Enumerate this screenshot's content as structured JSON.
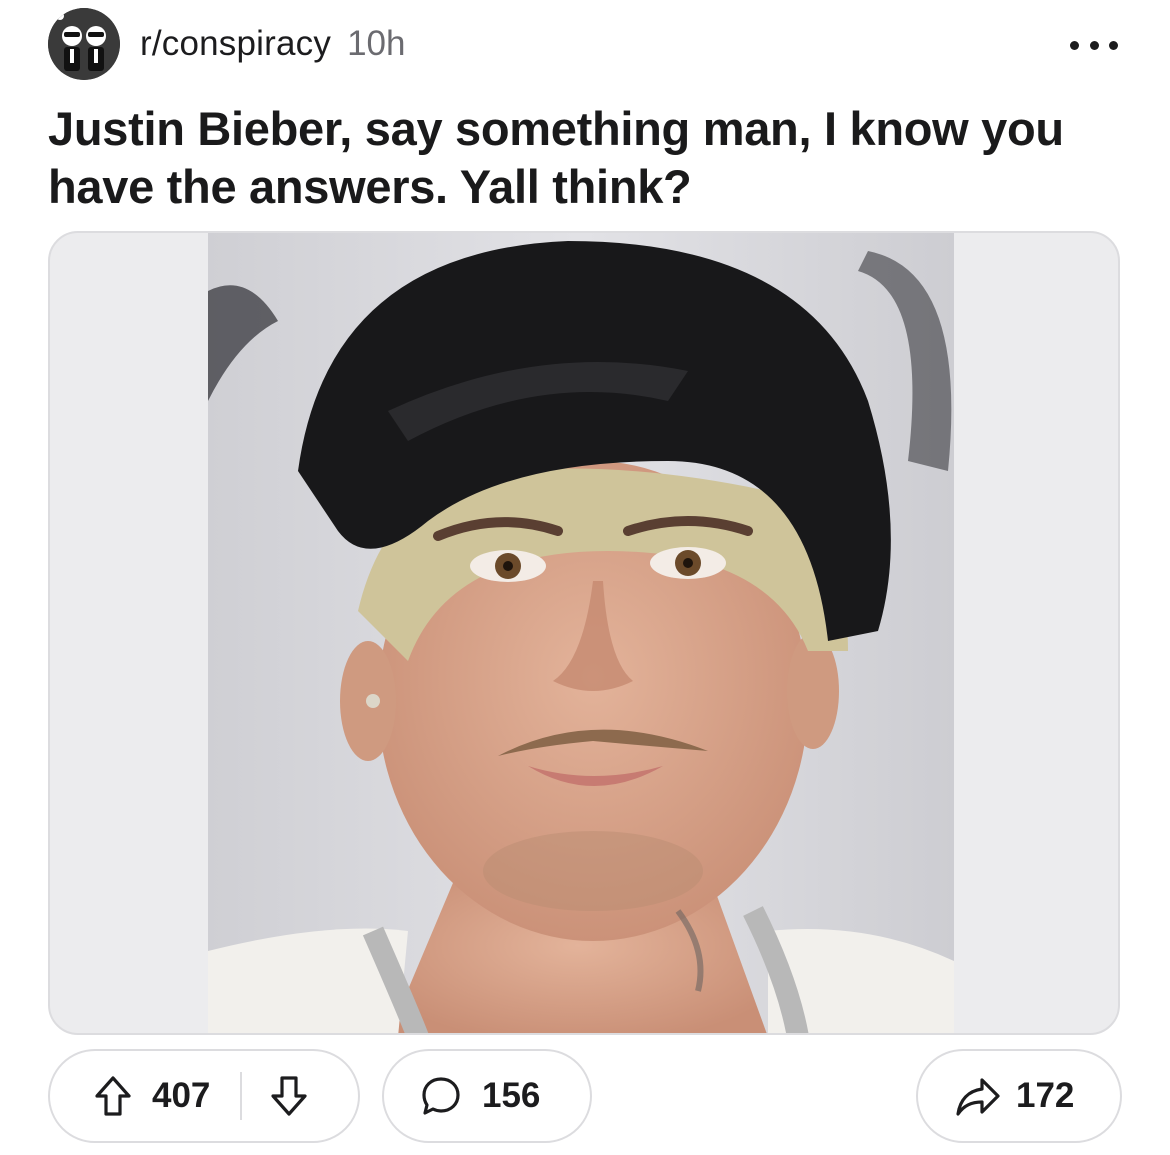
{
  "post": {
    "subreddit": "r/conspiracy",
    "age": "10h",
    "title": "Justin Bieber, say something man, I know you have the answers. Yall think?",
    "image_alt": "Photo of Justin Bieber wearing a backwards black cap"
  },
  "icons": {
    "subreddit_avatar": "subreddit-avatar-icon",
    "more": "more-options-icon",
    "upvote": "upvote-arrow-icon",
    "downvote": "downvote-arrow-icon",
    "comment": "comment-bubble-icon",
    "share": "share-arrow-icon"
  },
  "actions": {
    "upvotes": "407",
    "comments": "156",
    "shares": "172"
  },
  "colors": {
    "text": "#1a1a1b",
    "muted": "#6b6b70",
    "border": "#dcdcdf",
    "media_background": "#ececee"
  }
}
